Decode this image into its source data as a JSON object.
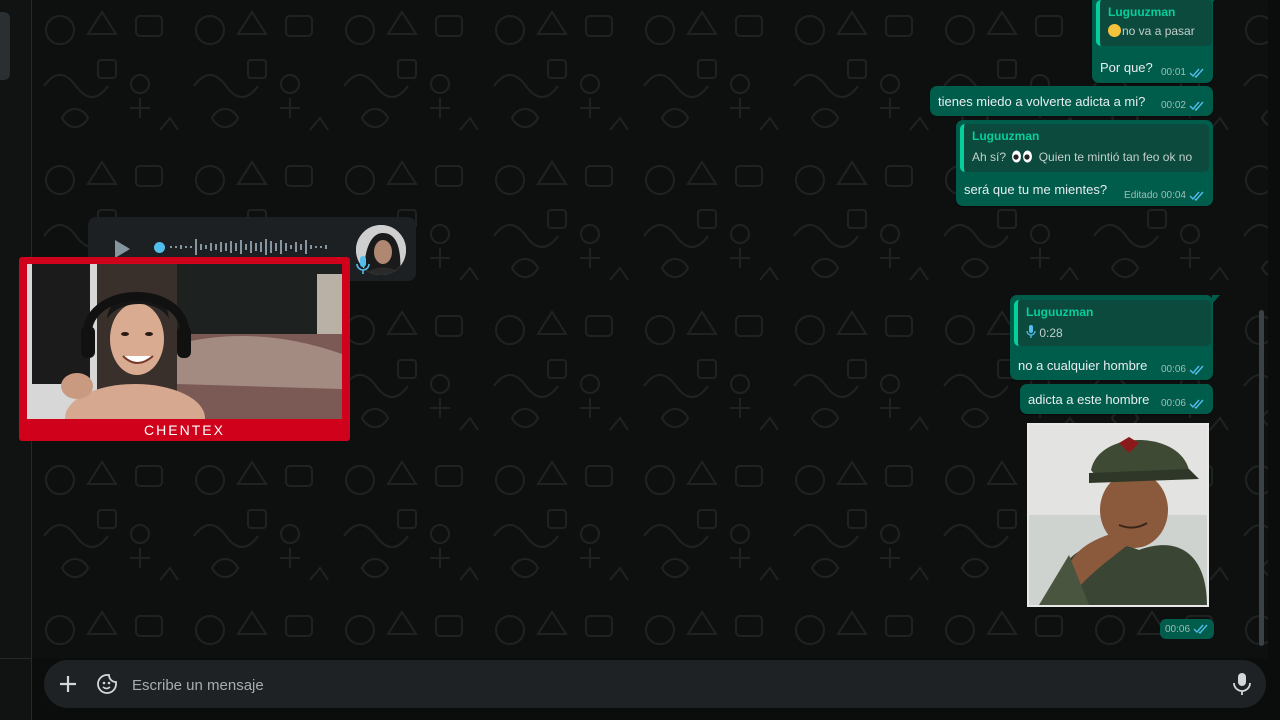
{
  "colors": {
    "outgoing_bubble": "#005c4b",
    "quote_accent": "#06cf9c",
    "read_tick": "#53bdeb",
    "webcam_frame": "#d0021b",
    "chat_background": "#0e100f"
  },
  "messages": [
    {
      "quote_author": "Luguuzman",
      "quote_text": "no va a pasar",
      "quote_emoji": "face-emoji",
      "text": "Por que?",
      "time": "00:01"
    },
    {
      "text": "tienes miedo a volverte adicta a mi?",
      "time": "00:02"
    },
    {
      "quote_author": "Luguuzman",
      "quote_text_before": "Ah sí?",
      "quote_emoji": "eyes-emoji",
      "quote_text_after": "Quien te mintió tan feo ok no",
      "text": "será que tu me mientes?",
      "edited": "Editado",
      "time": "00:04"
    },
    {
      "quote_author": "Luguuzman",
      "quote_voice_duration": "0:28",
      "text": "no a cualquier hombre",
      "time": "00:06"
    },
    {
      "text": "adicta a este hombre",
      "time": "00:06"
    },
    {
      "type": "image",
      "icon": "photo-thumbnail",
      "time": "00:06"
    }
  ],
  "incoming_voice": {
    "play_icon": "play-icon",
    "mic_icon": "mic-icon",
    "avatar_icon": "contact-avatar"
  },
  "webcam": {
    "label": "CHENTEX"
  },
  "composer": {
    "placeholder": "Escribe un mensaje",
    "value": "",
    "plus_icon": "plus-icon",
    "sticker_icon": "sticker-icon",
    "mic_icon": "mic-icon"
  }
}
